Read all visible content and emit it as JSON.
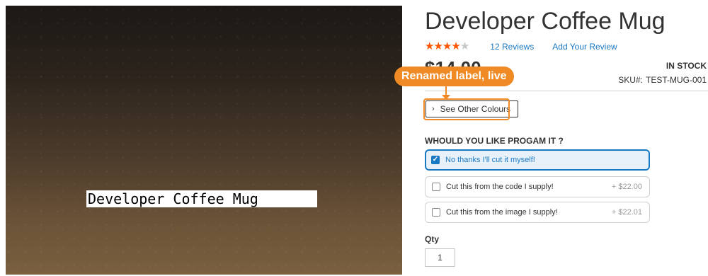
{
  "product": {
    "title": "Developer Coffee Mug",
    "image_label": "Developer Coffee Mug",
    "rating_stars": 4,
    "rating_max": 5,
    "reviews_link": "12  Reviews",
    "add_review_link": "Add Your Review",
    "price": "$14.00",
    "stock_status": "IN STOCK",
    "sku_label": "SKU#:",
    "sku_value": "TEST-MUG-001"
  },
  "annotation": {
    "badge_text": "Renamed label, live",
    "color": "#f08a24"
  },
  "see_colours_button": {
    "icon": "chevron-right-icon",
    "label": "See Other Colours"
  },
  "options": {
    "heading": "WHOULD YOU LIKE PROGAM IT ?",
    "items": [
      {
        "label": "No thanks I'll cut it myself!",
        "price": "",
        "checked": true
      },
      {
        "label": "Cut this from the code I supply!",
        "price": "+ $22.00",
        "checked": false
      },
      {
        "label": "Cut this from the image I supply!",
        "price": "+ $22.01",
        "checked": false
      }
    ]
  },
  "qty": {
    "label": "Qty",
    "value": "1"
  },
  "colors": {
    "accent": "#1979c3",
    "star": "#ff5501",
    "annotation": "#f08a24"
  }
}
